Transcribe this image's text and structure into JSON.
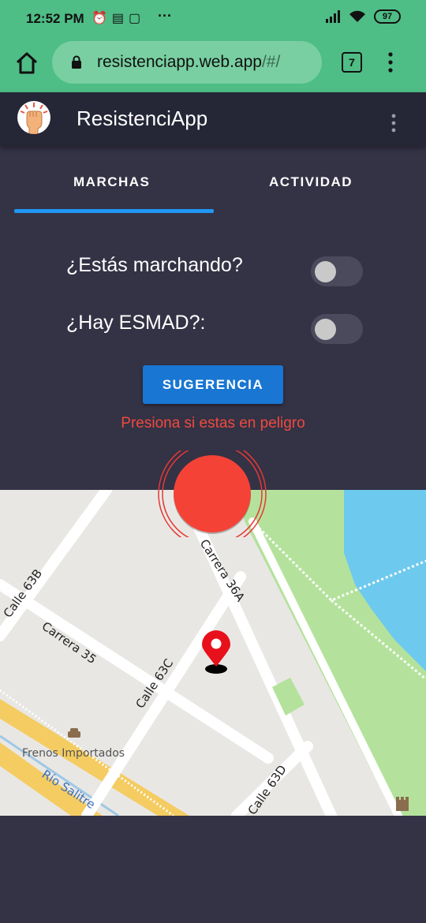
{
  "status_bar": {
    "time": "12:52 PM",
    "notification_icons": [
      "alarm-icon",
      "news-icon",
      "calendar-icon"
    ],
    "more": "···",
    "battery": "97"
  },
  "browser": {
    "url_host": "resistenciapp.web.app",
    "url_path": "/#/",
    "tab_count": "7"
  },
  "app": {
    "title": "ResistenciApp"
  },
  "tabs": [
    {
      "label": "MARCHAS",
      "active": true
    },
    {
      "label": "ACTIVIDAD",
      "active": false
    }
  ],
  "form": {
    "marching_label": "¿Estás marchando?",
    "marching_on": false,
    "esmad_label": "¿Hay ESMAD?:",
    "esmad_on": false,
    "suggestion_button": "SUGERENCIA",
    "danger_text": "Presiona si estas en peligro"
  },
  "map": {
    "street_labels": [
      "Calle 63B",
      "Carrera 35",
      "Calle 63C",
      "Carrera 36A",
      "Calle 63D"
    ],
    "poi": "Frenos Importados",
    "river": "Río Salitre",
    "marker": "location-pin-icon"
  },
  "colors": {
    "header_green": "#4fbd86",
    "app_bar": "#252636",
    "background": "#343245",
    "accent_blue": "#2196f3",
    "button_blue": "#1976d2",
    "danger_red": "#f44336"
  }
}
